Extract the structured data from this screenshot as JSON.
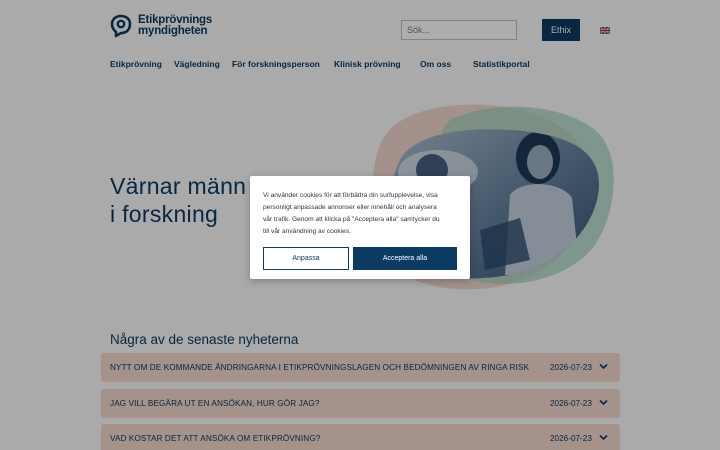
{
  "header": {
    "logo_line1": "Etikprövnings",
    "logo_line2": "myndigheten",
    "search_placeholder": "Sök...",
    "ethix_label": "Ethix",
    "language_icon": "uk-flag-icon"
  },
  "nav": {
    "items": [
      {
        "label": "Etikprövning"
      },
      {
        "label": "Vägledning"
      },
      {
        "label": "För forskningsperson"
      },
      {
        "label": "Klinisk prövning"
      },
      {
        "label": "Om oss"
      },
      {
        "label": "Statistikportal"
      }
    ]
  },
  "hero": {
    "title_line1": "Värnar männ",
    "title_line2": "i forskning"
  },
  "news": {
    "heading": "Några av de senaste nyheterna",
    "items": [
      {
        "title": "NYTT OM DE KOMMANDE ÄNDRINGARNA I ETIKPRÖVNINGSLAGEN OCH BEDÖMNINGEN AV RINGA RISK",
        "date": "2026-07-23"
      },
      {
        "title": "JAG VILL BEGÄRA UT EN ANSÖKAN, HUR GÖR JAG?",
        "date": "2026-07-23"
      },
      {
        "title": "VAD KOSTAR DET ATT ANSÖKA OM ETIKPRÖVNING?",
        "date": "2026-07-23"
      }
    ]
  },
  "cookie": {
    "line1": "Vi använder cookies för att förbättra din surfupplevelse, visa",
    "line2": "personligt anpassade annonser eller innehåll och analysera",
    "line3": "vår trafik. Genom att klicka på \"Acceptera alla\" samtycker du",
    "line4": "till vår användning av cookies.",
    "customize_label": "Anpassa",
    "accept_label": "Acceptera alla"
  },
  "colors": {
    "brand": "#0b3a63",
    "news_row_bg": "#f3d8cd",
    "blob_pink": "#e9b9a8",
    "blob_green": "#9fd1be"
  }
}
